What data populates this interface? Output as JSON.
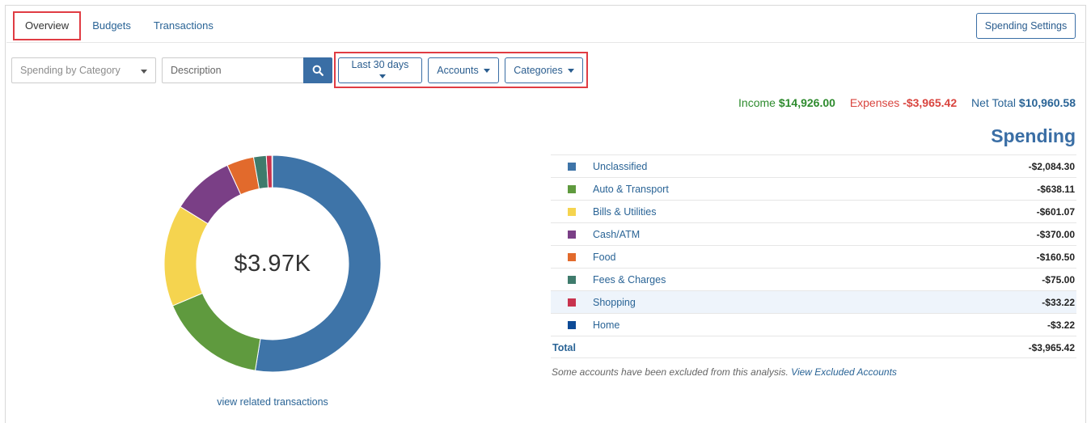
{
  "tabs": [
    {
      "label": "Overview",
      "active": true
    },
    {
      "label": "Budgets",
      "active": false
    },
    {
      "label": "Transactions",
      "active": false
    }
  ],
  "spending_settings_label": "Spending Settings",
  "filters": {
    "view_select": "Spending by Category",
    "description_placeholder": "Description",
    "date_range": "Last 30 days",
    "accounts": "Accounts",
    "categories": "Categories"
  },
  "summary": {
    "income_label": "Income",
    "income_value": "$14,926.00",
    "expenses_label": "Expenses",
    "expenses_value": "-$3,965.42",
    "net_label": "Net Total",
    "net_value": "$10,960.58"
  },
  "section_title": "Spending",
  "donut": {
    "center_label": "$3.97K",
    "view_related": "view related transactions"
  },
  "categories": [
    {
      "name": "Unclassified",
      "amount": "-$2,084.30",
      "value": 2084.3,
      "color": "#3e74a8"
    },
    {
      "name": "Auto & Transport",
      "amount": "-$638.11",
      "value": 638.11,
      "color": "#5f9a3e"
    },
    {
      "name": "Bills & Utilities",
      "amount": "-$601.07",
      "value": 601.07,
      "color": "#f5d44f"
    },
    {
      "name": "Cash/ATM",
      "amount": "-$370.00",
      "value": 370.0,
      "color": "#7a3f86"
    },
    {
      "name": "Food",
      "amount": "-$160.50",
      "value": 160.5,
      "color": "#e26a2c"
    },
    {
      "name": "Fees & Charges",
      "amount": "-$75.00",
      "value": 75.0,
      "color": "#3f7b6c"
    },
    {
      "name": "Shopping",
      "amount": "-$33.22",
      "value": 33.22,
      "color": "#c8334e"
    },
    {
      "name": "Home",
      "amount": "-$3.22",
      "value": 3.22,
      "color": "#0d4a96"
    }
  ],
  "total": {
    "label": "Total",
    "amount": "-$3,965.42"
  },
  "footnote": {
    "text": "Some accounts have been excluded from this analysis.",
    "link": "View Excluded Accounts"
  }
}
